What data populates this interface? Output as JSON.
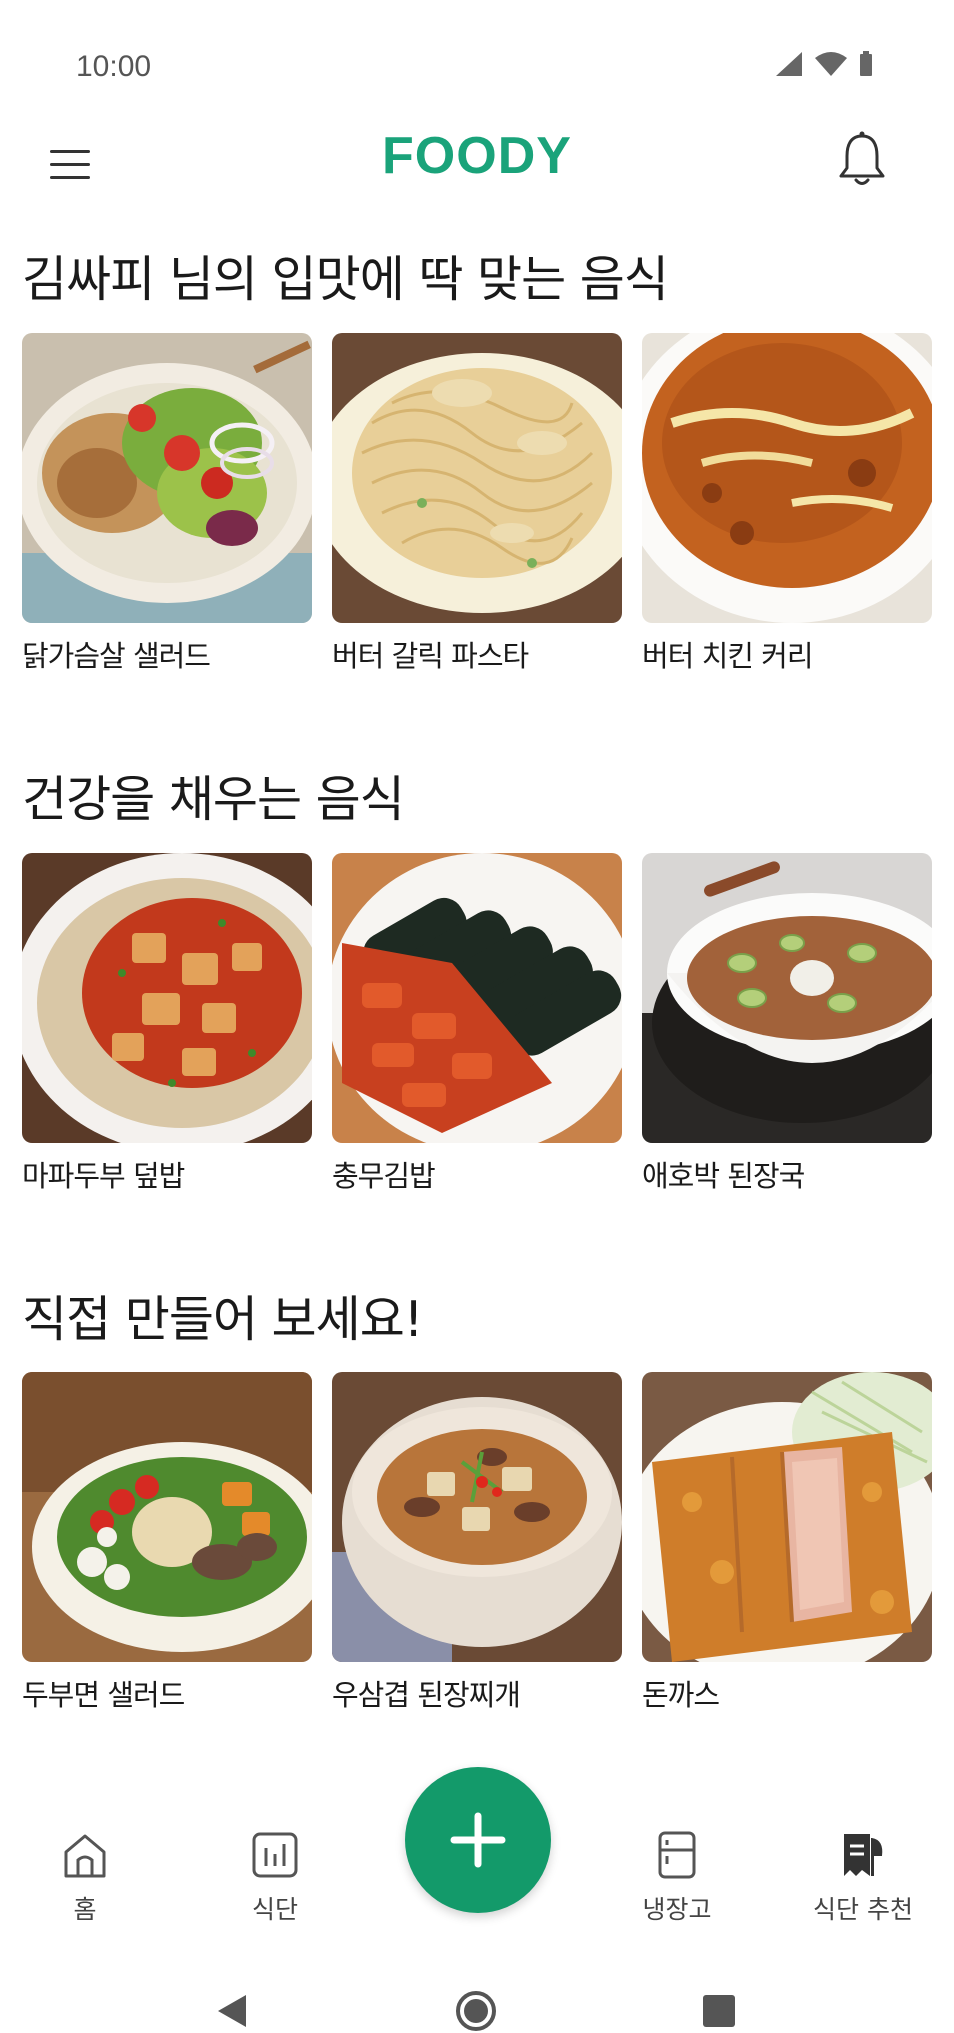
{
  "status_bar": {
    "time": "10:00"
  },
  "header": {
    "logo": "FOODY"
  },
  "sections": [
    {
      "title": "김싸피 님의 입맛에 딱 맞는 음식",
      "items": [
        {
          "name": "닭가슴살 샐러드"
        },
        {
          "name": "버터 갈릭 파스타"
        },
        {
          "name": "버터 치킨 커리"
        }
      ]
    },
    {
      "title": "건강을 채우는 음식",
      "items": [
        {
          "name": "마파두부 덮밥"
        },
        {
          "name": "충무김밥"
        },
        {
          "name": "애호박 된장국"
        }
      ]
    },
    {
      "title": "직접 만들어 보세요!",
      "items": [
        {
          "name": "두부면 샐러드"
        },
        {
          "name": "우삼겹 된장찌개"
        },
        {
          "name": "돈까스"
        }
      ]
    }
  ],
  "bottom_nav": {
    "home": "홈",
    "diet": "식단",
    "fridge": "냉장고",
    "recommend": "식단 추천",
    "add_icon": "plus-icon"
  },
  "colors": {
    "brand": "#1aa37a",
    "fab": "#139a6a"
  }
}
